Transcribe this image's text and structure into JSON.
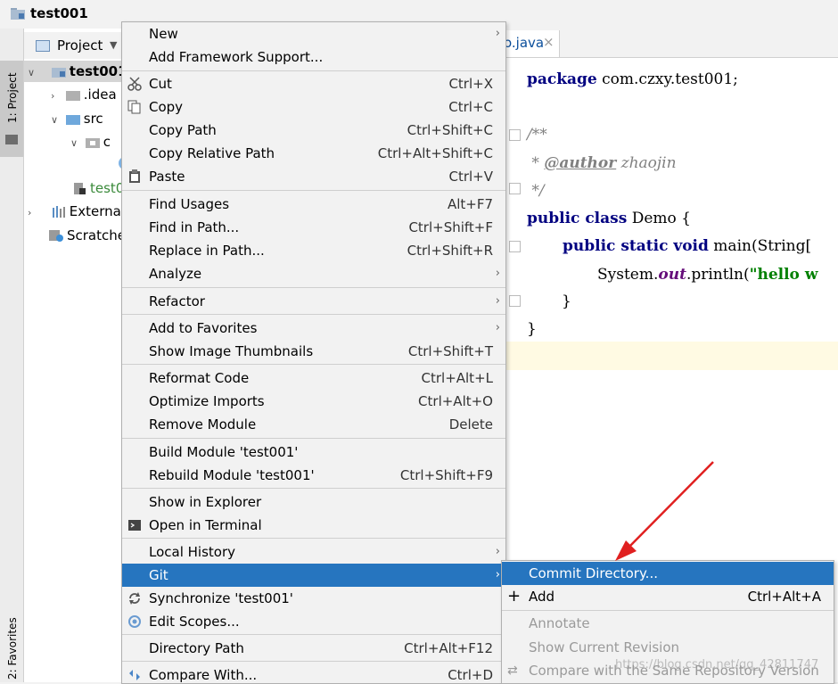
{
  "window": {
    "title": "test001"
  },
  "toolstrip": {
    "project_label": "1: Project",
    "favorites_label": "2: Favorites"
  },
  "project": {
    "header_label": "Project",
    "tree": [
      {
        "label": "test001"
      },
      {
        "label": ".idea"
      },
      {
        "label": "src"
      },
      {
        "label": "c"
      },
      {
        "label": "test0"
      },
      {
        "label": "External"
      },
      {
        "label": "Scratche"
      }
    ]
  },
  "editor": {
    "tab_label": "o.java",
    "code": {
      "package_kw": "package",
      "package_rest": " com.czxy.test001;",
      "doc_open": "/**",
      "doc_star": " * ",
      "author_tag": "@author",
      "author_name": " zhaojin",
      "doc_close": " */",
      "public_kw": "public",
      "class_kw": " class",
      "class_name": " Demo {",
      "public_static_void": "public static void",
      "main_sig": " main(String[",
      "sys": "System.",
      "out": "out",
      "println": ".println(",
      "hello_str": "\"hello w",
      "close_inner": "}",
      "close_outer": "}"
    }
  },
  "menu": {
    "items": [
      {
        "label": "New",
        "shortcut": ""
      },
      {
        "label": "Add Framework Support...",
        "shortcut": ""
      },
      {
        "label": "Cut",
        "shortcut": "Ctrl+X"
      },
      {
        "label": "Copy",
        "shortcut": "Ctrl+C"
      },
      {
        "label": "Copy Path",
        "shortcut": "Ctrl+Shift+C"
      },
      {
        "label": "Copy Relative Path",
        "shortcut": "Ctrl+Alt+Shift+C"
      },
      {
        "label": "Paste",
        "shortcut": "Ctrl+V"
      },
      {
        "label": "Find Usages",
        "shortcut": "Alt+F7"
      },
      {
        "label": "Find in Path...",
        "shortcut": "Ctrl+Shift+F"
      },
      {
        "label": "Replace in Path...",
        "shortcut": "Ctrl+Shift+R"
      },
      {
        "label": "Analyze",
        "shortcut": ""
      },
      {
        "label": "Refactor",
        "shortcut": ""
      },
      {
        "label": "Add to Favorites",
        "shortcut": ""
      },
      {
        "label": "Show Image Thumbnails",
        "shortcut": "Ctrl+Shift+T"
      },
      {
        "label": "Reformat Code",
        "shortcut": "Ctrl+Alt+L"
      },
      {
        "label": "Optimize Imports",
        "shortcut": "Ctrl+Alt+O"
      },
      {
        "label": "Remove Module",
        "shortcut": "Delete"
      },
      {
        "label": "Build Module 'test001'",
        "shortcut": ""
      },
      {
        "label": "Rebuild Module 'test001'",
        "shortcut": "Ctrl+Shift+F9"
      },
      {
        "label": "Show in Explorer",
        "shortcut": ""
      },
      {
        "label": "Open in Terminal",
        "shortcut": ""
      },
      {
        "label": "Local History",
        "shortcut": ""
      },
      {
        "label": "Git",
        "shortcut": ""
      },
      {
        "label": "Synchronize 'test001'",
        "shortcut": ""
      },
      {
        "label": "Edit Scopes...",
        "shortcut": ""
      },
      {
        "label": "Directory Path",
        "shortcut": "Ctrl+Alt+F12"
      },
      {
        "label": "Compare With...",
        "shortcut": "Ctrl+D"
      }
    ]
  },
  "git_submenu": {
    "items": [
      {
        "label": "Commit Directory...",
        "shortcut": ""
      },
      {
        "label": "Add",
        "shortcut": "Ctrl+Alt+A"
      },
      {
        "label": "Annotate",
        "shortcut": ""
      },
      {
        "label": "Show Current Revision",
        "shortcut": ""
      },
      {
        "label": "Compare with the Same Repository Version",
        "shortcut": ""
      }
    ]
  },
  "watermark": "https://blog.csdn.net/qq_42811747",
  "colors": {
    "highlight": "#2675bf",
    "keyword": "#000080",
    "string": "#008000",
    "annotation_arrow": "#e02020"
  }
}
